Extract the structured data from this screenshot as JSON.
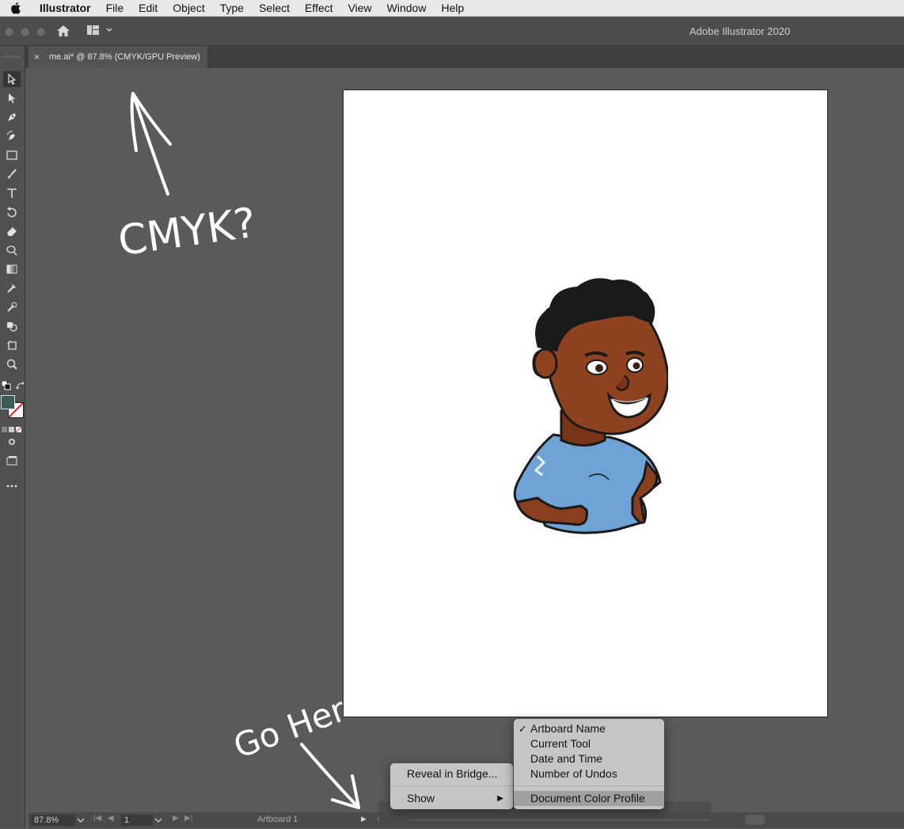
{
  "menubar": {
    "app_name": "Illustrator",
    "items": [
      "File",
      "Edit",
      "Object",
      "Type",
      "Select",
      "Effect",
      "View",
      "Window",
      "Help"
    ]
  },
  "appbar": {
    "title": "Adobe Illustrator 2020"
  },
  "document_tab": {
    "close": "×",
    "title": "me.ai* @ 87.8% (CMYK/GPU Preview)"
  },
  "tools": [
    "selection-tool",
    "direct-selection-tool",
    "pen-tool",
    "curvature-tool",
    "rectangle-tool",
    "paintbrush-tool",
    "type-tool",
    "rotate-tool",
    "eraser-tool",
    "warp-tool",
    "gradient-tool",
    "eyedropper-tool",
    "blend-tool",
    "shape-builder-tool",
    "artboard-tool",
    "zoom-tool"
  ],
  "annotations": {
    "top": "CMYK?",
    "bottom": "Go Here"
  },
  "context_menu": {
    "items": [
      {
        "label": "Reveal in Bridge..."
      },
      {
        "label": "Show",
        "has_submenu": true,
        "arrow": "▶"
      }
    ]
  },
  "submenu": {
    "checkmark": "✓",
    "items": [
      {
        "label": "Artboard Name",
        "checked": true
      },
      {
        "label": "Current Tool"
      },
      {
        "label": "Date and Time"
      },
      {
        "label": "Number of Undos"
      },
      {
        "label": "Document Color Profile",
        "highlighted": true
      }
    ]
  },
  "statusbar": {
    "zoom": "87.8%",
    "page": "1",
    "info": "Artboard 1",
    "first": "|◀",
    "prev": "◀",
    "next": "▶",
    "last": "▶|",
    "play": "▶",
    "collapse": "‹"
  },
  "colors": {
    "accent_fill": "#3d5c57",
    "ui_bg": "#5a5a5a",
    "menu_bg": "#c8c8c8"
  }
}
